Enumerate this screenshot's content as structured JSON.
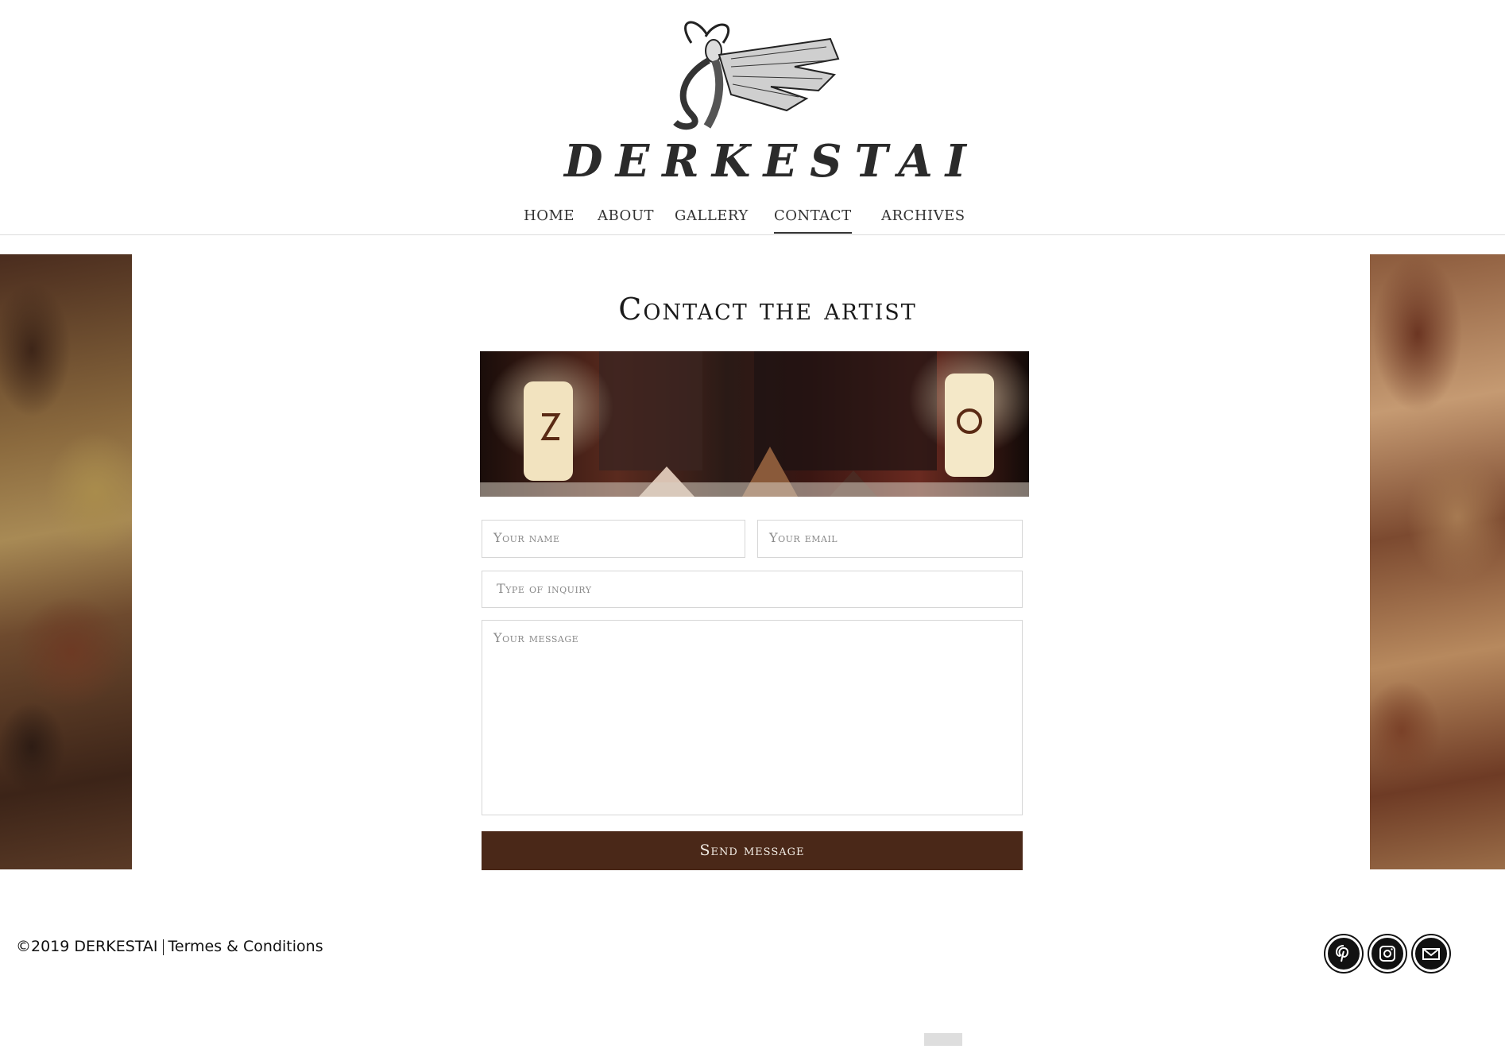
{
  "brand": {
    "name": "DERKESTAI"
  },
  "nav": {
    "items": [
      {
        "label": "Home"
      },
      {
        "label": "About"
      },
      {
        "label": "Gallery"
      },
      {
        "label": "Contact"
      },
      {
        "label": "Archives"
      }
    ],
    "active": "Contact"
  },
  "main": {
    "title": "Contact the artist",
    "form": {
      "name_placeholder": "Your name",
      "email_placeholder": "Your email",
      "inquiry_placeholder": "Type of inquiry",
      "message_placeholder": "Your message",
      "send_label": "Send message"
    }
  },
  "footer": {
    "copyright": "©2019 DERKESTAI",
    "terms": "Termes & Conditions",
    "social": [
      "pinterest-icon",
      "instagram-icon",
      "mail-icon"
    ]
  },
  "colors": {
    "button_bg": "#4a2818",
    "button_text": "#f3ede5"
  }
}
